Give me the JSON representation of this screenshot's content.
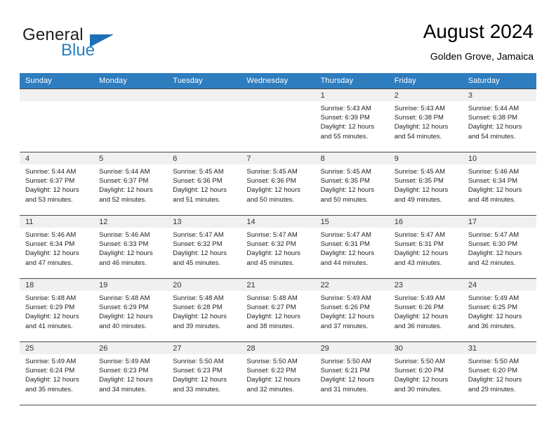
{
  "brand": {
    "name_top": "General",
    "name_bottom": "Blue",
    "triangle_icon": "triangle-icon",
    "color_blue": "#2580c3",
    "color_dark": "#231f20"
  },
  "header": {
    "title": "August 2024",
    "subtitle": "Golden Grove, Jamaica"
  },
  "theme": {
    "header_row_bg": "#2e7dbf",
    "daynum_band_bg": "#f0f0f0",
    "grid_line": "#4a4a4a"
  },
  "weekday_headers": [
    "Sunday",
    "Monday",
    "Tuesday",
    "Wednesday",
    "Thursday",
    "Friday",
    "Saturday"
  ],
  "weeks": [
    [
      {
        "day": "",
        "sunrise": "",
        "sunset": "",
        "daylight_line1": "",
        "daylight_line2": "",
        "empty": true
      },
      {
        "day": "",
        "sunrise": "",
        "sunset": "",
        "daylight_line1": "",
        "daylight_line2": "",
        "empty": true
      },
      {
        "day": "",
        "sunrise": "",
        "sunset": "",
        "daylight_line1": "",
        "daylight_line2": "",
        "empty": true
      },
      {
        "day": "",
        "sunrise": "",
        "sunset": "",
        "daylight_line1": "",
        "daylight_line2": "",
        "empty": true
      },
      {
        "day": "1",
        "sunrise": "Sunrise: 5:43 AM",
        "sunset": "Sunset: 6:39 PM",
        "daylight_line1": "Daylight: 12 hours",
        "daylight_line2": "and 55 minutes."
      },
      {
        "day": "2",
        "sunrise": "Sunrise: 5:43 AM",
        "sunset": "Sunset: 6:38 PM",
        "daylight_line1": "Daylight: 12 hours",
        "daylight_line2": "and 54 minutes."
      },
      {
        "day": "3",
        "sunrise": "Sunrise: 5:44 AM",
        "sunset": "Sunset: 6:38 PM",
        "daylight_line1": "Daylight: 12 hours",
        "daylight_line2": "and 54 minutes."
      }
    ],
    [
      {
        "day": "4",
        "sunrise": "Sunrise: 5:44 AM",
        "sunset": "Sunset: 6:37 PM",
        "daylight_line1": "Daylight: 12 hours",
        "daylight_line2": "and 53 minutes."
      },
      {
        "day": "5",
        "sunrise": "Sunrise: 5:44 AM",
        "sunset": "Sunset: 6:37 PM",
        "daylight_line1": "Daylight: 12 hours",
        "daylight_line2": "and 52 minutes."
      },
      {
        "day": "6",
        "sunrise": "Sunrise: 5:45 AM",
        "sunset": "Sunset: 6:36 PM",
        "daylight_line1": "Daylight: 12 hours",
        "daylight_line2": "and 51 minutes."
      },
      {
        "day": "7",
        "sunrise": "Sunrise: 5:45 AM",
        "sunset": "Sunset: 6:36 PM",
        "daylight_line1": "Daylight: 12 hours",
        "daylight_line2": "and 50 minutes."
      },
      {
        "day": "8",
        "sunrise": "Sunrise: 5:45 AM",
        "sunset": "Sunset: 6:35 PM",
        "daylight_line1": "Daylight: 12 hours",
        "daylight_line2": "and 50 minutes."
      },
      {
        "day": "9",
        "sunrise": "Sunrise: 5:45 AM",
        "sunset": "Sunset: 6:35 PM",
        "daylight_line1": "Daylight: 12 hours",
        "daylight_line2": "and 49 minutes."
      },
      {
        "day": "10",
        "sunrise": "Sunrise: 5:46 AM",
        "sunset": "Sunset: 6:34 PM",
        "daylight_line1": "Daylight: 12 hours",
        "daylight_line2": "and 48 minutes."
      }
    ],
    [
      {
        "day": "11",
        "sunrise": "Sunrise: 5:46 AM",
        "sunset": "Sunset: 6:34 PM",
        "daylight_line1": "Daylight: 12 hours",
        "daylight_line2": "and 47 minutes."
      },
      {
        "day": "12",
        "sunrise": "Sunrise: 5:46 AM",
        "sunset": "Sunset: 6:33 PM",
        "daylight_line1": "Daylight: 12 hours",
        "daylight_line2": "and 46 minutes."
      },
      {
        "day": "13",
        "sunrise": "Sunrise: 5:47 AM",
        "sunset": "Sunset: 6:32 PM",
        "daylight_line1": "Daylight: 12 hours",
        "daylight_line2": "and 45 minutes."
      },
      {
        "day": "14",
        "sunrise": "Sunrise: 5:47 AM",
        "sunset": "Sunset: 6:32 PM",
        "daylight_line1": "Daylight: 12 hours",
        "daylight_line2": "and 45 minutes."
      },
      {
        "day": "15",
        "sunrise": "Sunrise: 5:47 AM",
        "sunset": "Sunset: 6:31 PM",
        "daylight_line1": "Daylight: 12 hours",
        "daylight_line2": "and 44 minutes."
      },
      {
        "day": "16",
        "sunrise": "Sunrise: 5:47 AM",
        "sunset": "Sunset: 6:31 PM",
        "daylight_line1": "Daylight: 12 hours",
        "daylight_line2": "and 43 minutes."
      },
      {
        "day": "17",
        "sunrise": "Sunrise: 5:47 AM",
        "sunset": "Sunset: 6:30 PM",
        "daylight_line1": "Daylight: 12 hours",
        "daylight_line2": "and 42 minutes."
      }
    ],
    [
      {
        "day": "18",
        "sunrise": "Sunrise: 5:48 AM",
        "sunset": "Sunset: 6:29 PM",
        "daylight_line1": "Daylight: 12 hours",
        "daylight_line2": "and 41 minutes."
      },
      {
        "day": "19",
        "sunrise": "Sunrise: 5:48 AM",
        "sunset": "Sunset: 6:29 PM",
        "daylight_line1": "Daylight: 12 hours",
        "daylight_line2": "and 40 minutes."
      },
      {
        "day": "20",
        "sunrise": "Sunrise: 5:48 AM",
        "sunset": "Sunset: 6:28 PM",
        "daylight_line1": "Daylight: 12 hours",
        "daylight_line2": "and 39 minutes."
      },
      {
        "day": "21",
        "sunrise": "Sunrise: 5:48 AM",
        "sunset": "Sunset: 6:27 PM",
        "daylight_line1": "Daylight: 12 hours",
        "daylight_line2": "and 38 minutes."
      },
      {
        "day": "22",
        "sunrise": "Sunrise: 5:49 AM",
        "sunset": "Sunset: 6:26 PM",
        "daylight_line1": "Daylight: 12 hours",
        "daylight_line2": "and 37 minutes."
      },
      {
        "day": "23",
        "sunrise": "Sunrise: 5:49 AM",
        "sunset": "Sunset: 6:26 PM",
        "daylight_line1": "Daylight: 12 hours",
        "daylight_line2": "and 36 minutes."
      },
      {
        "day": "24",
        "sunrise": "Sunrise: 5:49 AM",
        "sunset": "Sunset: 6:25 PM",
        "daylight_line1": "Daylight: 12 hours",
        "daylight_line2": "and 36 minutes."
      }
    ],
    [
      {
        "day": "25",
        "sunrise": "Sunrise: 5:49 AM",
        "sunset": "Sunset: 6:24 PM",
        "daylight_line1": "Daylight: 12 hours",
        "daylight_line2": "and 35 minutes."
      },
      {
        "day": "26",
        "sunrise": "Sunrise: 5:49 AM",
        "sunset": "Sunset: 6:23 PM",
        "daylight_line1": "Daylight: 12 hours",
        "daylight_line2": "and 34 minutes."
      },
      {
        "day": "27",
        "sunrise": "Sunrise: 5:50 AM",
        "sunset": "Sunset: 6:23 PM",
        "daylight_line1": "Daylight: 12 hours",
        "daylight_line2": "and 33 minutes."
      },
      {
        "day": "28",
        "sunrise": "Sunrise: 5:50 AM",
        "sunset": "Sunset: 6:22 PM",
        "daylight_line1": "Daylight: 12 hours",
        "daylight_line2": "and 32 minutes."
      },
      {
        "day": "29",
        "sunrise": "Sunrise: 5:50 AM",
        "sunset": "Sunset: 6:21 PM",
        "daylight_line1": "Daylight: 12 hours",
        "daylight_line2": "and 31 minutes."
      },
      {
        "day": "30",
        "sunrise": "Sunrise: 5:50 AM",
        "sunset": "Sunset: 6:20 PM",
        "daylight_line1": "Daylight: 12 hours",
        "daylight_line2": "and 30 minutes."
      },
      {
        "day": "31",
        "sunrise": "Sunrise: 5:50 AM",
        "sunset": "Sunset: 6:20 PM",
        "daylight_line1": "Daylight: 12 hours",
        "daylight_line2": "and 29 minutes."
      }
    ]
  ]
}
